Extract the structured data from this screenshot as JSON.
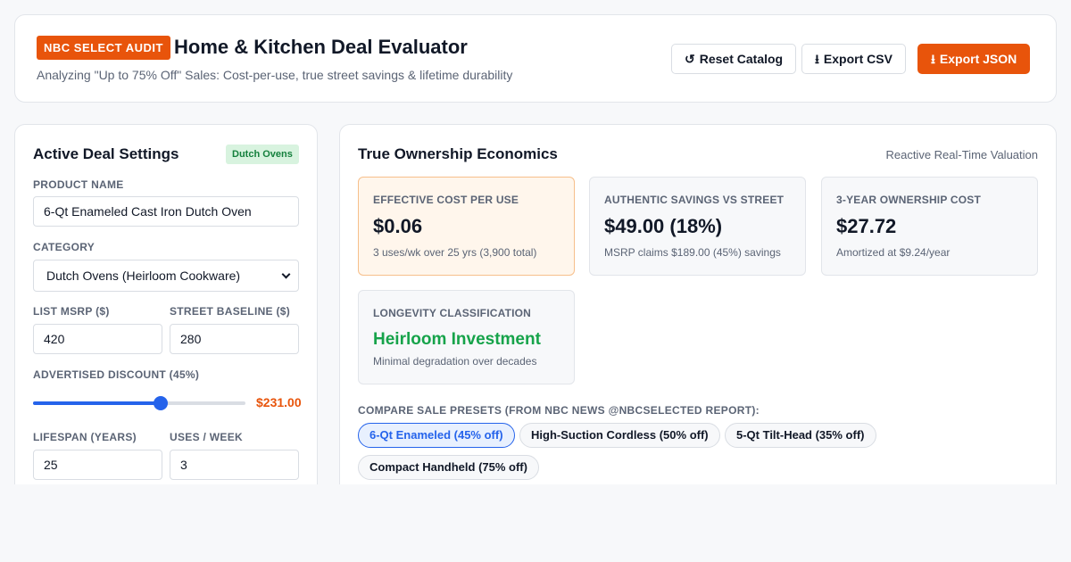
{
  "header": {
    "badge": "NBC SELECT AUDIT",
    "title": "Home & Kitchen Deal Evaluator",
    "subtitle": "Analyzing \"Up to 75% Off\" Sales: Cost-per-use, true street savings & lifetime durability",
    "buttons": {
      "reset": {
        "icon": "↺",
        "label": "Reset Catalog"
      },
      "csv": {
        "icon": "⭳",
        "label": "Export CSV"
      },
      "json": {
        "icon": "⭳",
        "label": "Export JSON"
      }
    }
  },
  "settings": {
    "title": "Active Deal Settings",
    "category_tag": "Dutch Ovens",
    "product_name": {
      "label": "PRODUCT NAME",
      "value": "6-Qt Enameled Cast Iron Dutch Oven"
    },
    "category": {
      "label": "CATEGORY",
      "value": "Dutch Ovens (Heirloom Cookware)"
    },
    "msrp": {
      "label": "LIST MSRP ($)",
      "value": "420"
    },
    "street": {
      "label": "STREET BASELINE ($)",
      "value": "280"
    },
    "discount": {
      "label": "ADVERTISED DISCOUNT (45%)",
      "percent": 45,
      "min": 0,
      "max": 75,
      "sale_price": "$231.00"
    },
    "lifespan": {
      "label": "LIFESPAN (YEARS)",
      "value": "25"
    },
    "uses": {
      "label": "USES / WEEK",
      "value": "3"
    }
  },
  "economics": {
    "title": "True Ownership Economics",
    "hint": "Reactive Real-Time Valuation",
    "metrics": [
      {
        "label": "EFFECTIVE COST PER USE",
        "value": "$0.06",
        "note": "3 uses/wk over 25 yrs (3,900 total)"
      },
      {
        "label": "AUTHENTIC SAVINGS VS STREET",
        "value": "$49.00 (18%)",
        "note": "MSRP claims $189.00 (45%) savings"
      },
      {
        "label": "3-YEAR OWNERSHIP COST",
        "value": "$27.72",
        "note": "Amortized at $9.24/year"
      },
      {
        "label": "LONGEVITY CLASSIFICATION",
        "value": "Heirloom Investment",
        "note": "Minimal degradation over decades"
      }
    ],
    "presets_label": "COMPARE SALE PRESETS (FROM NBC NEWS @NBCSELECTED REPORT):",
    "presets": [
      "6-Qt Enameled (45% off)",
      "High-Suction Cordless (50% off)",
      "5-Qt Tilt-Head (35% off)",
      "Compact Handheld (75% off)"
    ]
  },
  "colors": {
    "accent": "#e8540b",
    "slider": "#2563eb",
    "positive": "#16a34a"
  }
}
